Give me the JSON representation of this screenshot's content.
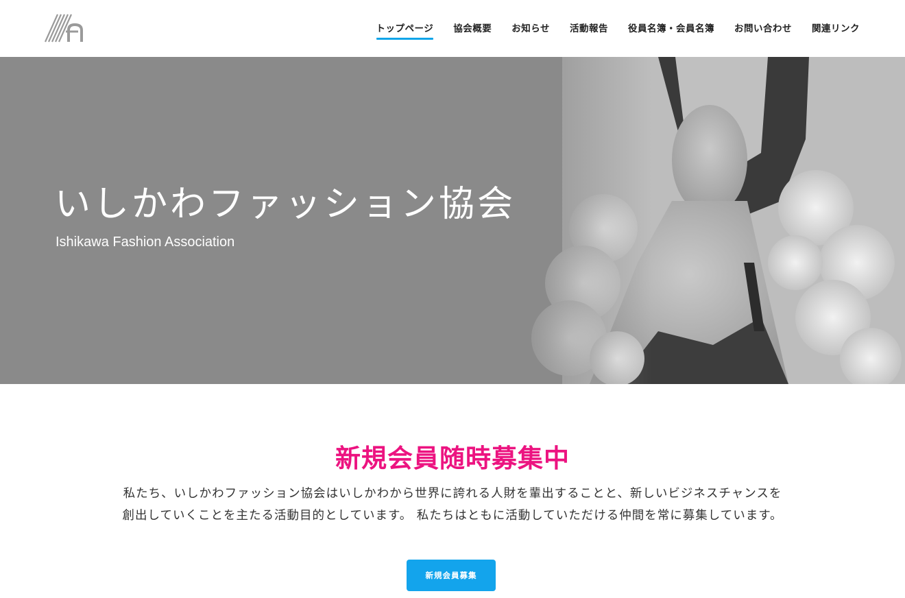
{
  "header": {
    "logo_icon": "ifa-stripes-logo-icon",
    "nav": [
      {
        "label": "トップページ",
        "active": true
      },
      {
        "label": "協会概要",
        "active": false
      },
      {
        "label": "お知らせ",
        "active": false
      },
      {
        "label": "活動報告",
        "active": false
      },
      {
        "label": "役員名簿・会員名簿",
        "active": false
      },
      {
        "label": "お問い合わせ",
        "active": false
      },
      {
        "label": "関連リンク",
        "active": false
      }
    ]
  },
  "hero": {
    "title": "いしかわファッション協会",
    "subtitle": "Ishikawa Fashion Association"
  },
  "recruit": {
    "heading": "新規会員随時募集中",
    "body": "私たち、いしかわファッション協会はいしかわから世界に誇れる人財を輩出することと、新しいビジネスチャンスを創出していくことを主たる活動目的としています。 私たちはともに活動していただける仲間を常に募集しています。",
    "button_label": "新規会員募集"
  },
  "colors": {
    "accent_blue": "#13a4ec",
    "heading_pink": "#ec1380",
    "hero_gray": "#8a8a8a"
  }
}
